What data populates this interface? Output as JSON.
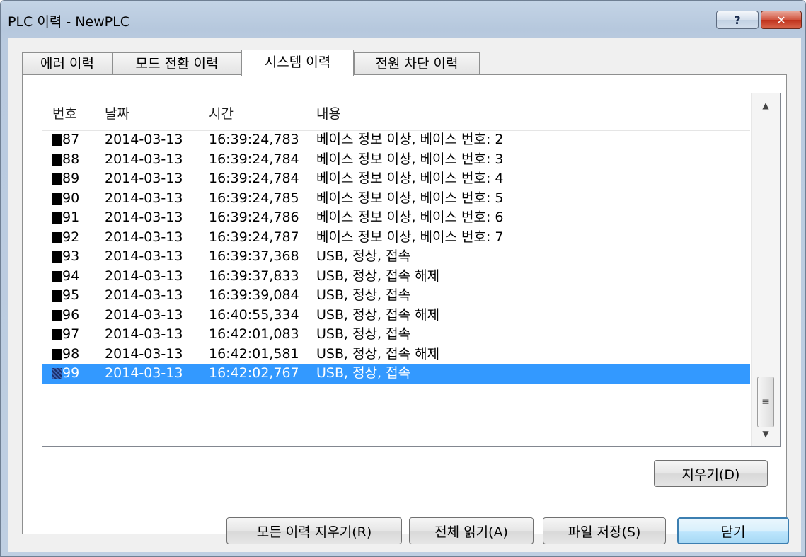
{
  "window": {
    "title": "PLC 이력 - NewPLC",
    "help_label": "?",
    "close_label": "✕"
  },
  "tabs": [
    {
      "label": "에러 이력",
      "active": false
    },
    {
      "label": "모드 전환 이력",
      "active": false
    },
    {
      "label": "시스템 이력",
      "active": true
    },
    {
      "label": "전원 차단 이력",
      "active": false
    }
  ],
  "list": {
    "columns": [
      "번호",
      "날짜",
      "시간",
      "내용"
    ],
    "rows": [
      {
        "num": "87",
        "date": "2014-03-13",
        "time": "16:39:24,783",
        "content": "베이스 정보 이상, 베이스 번호: 2"
      },
      {
        "num": "88",
        "date": "2014-03-13",
        "time": "16:39:24,784",
        "content": "베이스 정보 이상, 베이스 번호: 3"
      },
      {
        "num": "89",
        "date": "2014-03-13",
        "time": "16:39:24,784",
        "content": "베이스 정보 이상, 베이스 번호: 4"
      },
      {
        "num": "90",
        "date": "2014-03-13",
        "time": "16:39:24,785",
        "content": "베이스 정보 이상, 베이스 번호: 5"
      },
      {
        "num": "91",
        "date": "2014-03-13",
        "time": "16:39:24,786",
        "content": "베이스 정보 이상, 베이스 번호: 6"
      },
      {
        "num": "92",
        "date": "2014-03-13",
        "time": "16:39:24,787",
        "content": "베이스 정보 이상, 베이스 번호: 7"
      },
      {
        "num": "93",
        "date": "2014-03-13",
        "time": "16:39:37,368",
        "content": "USB, 정상, 접속"
      },
      {
        "num": "94",
        "date": "2014-03-13",
        "time": "16:39:37,833",
        "content": "USB, 정상, 접속 해제"
      },
      {
        "num": "95",
        "date": "2014-03-13",
        "time": "16:39:39,084",
        "content": "USB, 정상, 접속"
      },
      {
        "num": "96",
        "date": "2014-03-13",
        "time": "16:40:55,334",
        "content": "USB, 정상, 접속 해제"
      },
      {
        "num": "97",
        "date": "2014-03-13",
        "time": "16:42:01,083",
        "content": "USB, 정상, 접속"
      },
      {
        "num": "98",
        "date": "2014-03-13",
        "time": "16:42:01,581",
        "content": "USB, 정상, 접속 해제"
      },
      {
        "num": "99",
        "date": "2014-03-13",
        "time": "16:42:02,767",
        "content": "USB, 정상, 접속",
        "selected": true
      }
    ]
  },
  "buttons": {
    "clear": "지우기(D)",
    "clear_all": "모든 이력 지우기(R)",
    "read_all": "전체 읽기(A)",
    "save_file": "파일 저장(S)",
    "close": "닫기"
  },
  "colors": {
    "selection": "#3399ff",
    "default_button_border": "#3c7fb1"
  }
}
